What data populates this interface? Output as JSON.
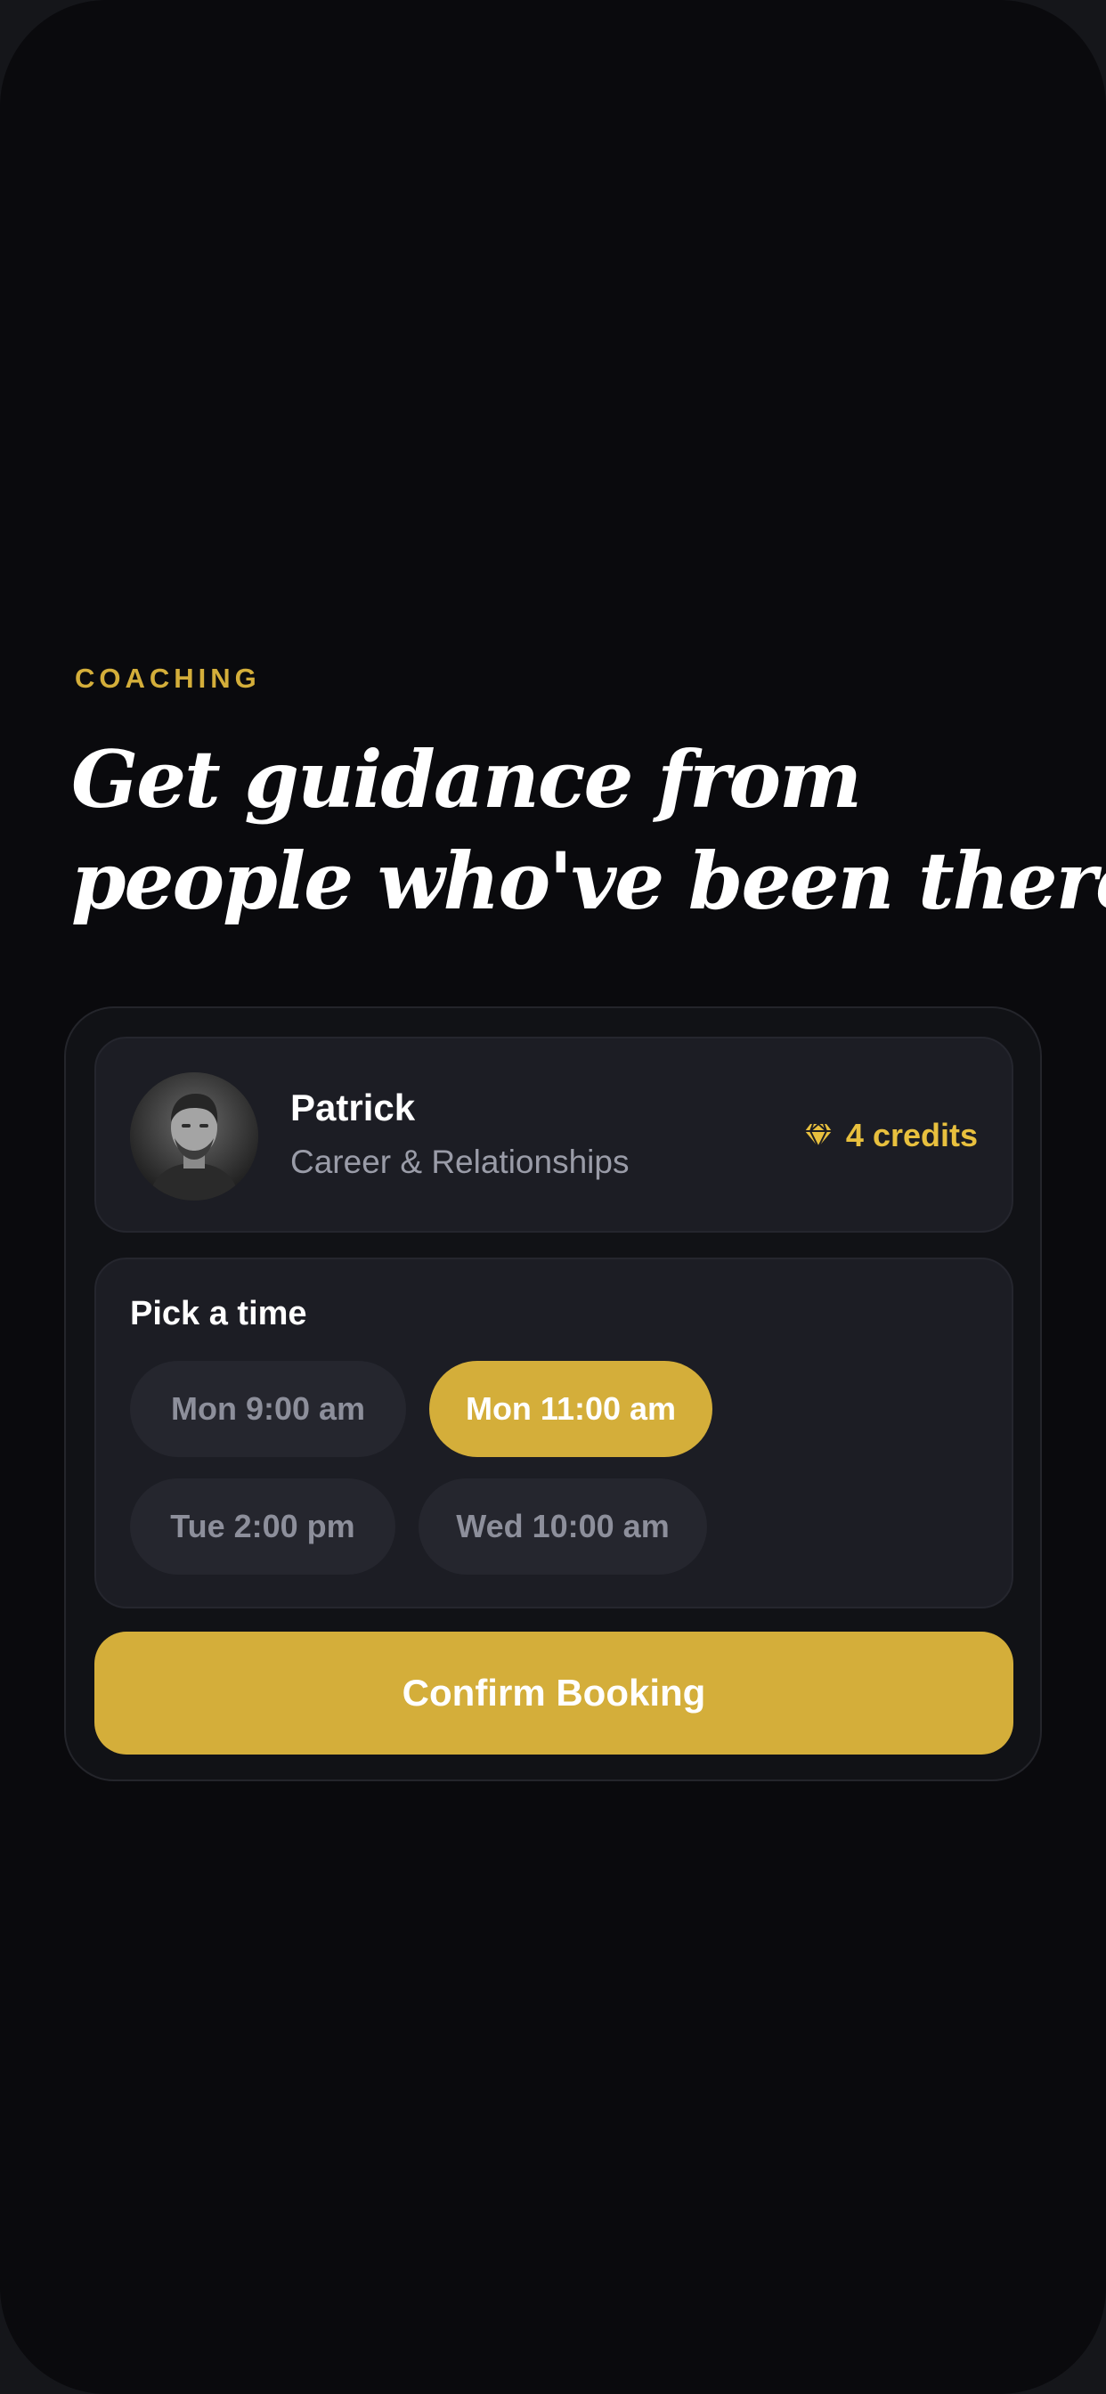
{
  "section": {
    "eyebrow": "COACHING",
    "headline_line1": "Get guidance from",
    "headline_line2": "people who've been there."
  },
  "coach": {
    "name": "Patrick",
    "specialty": "Career & Relationships",
    "credits_label": "4 credits",
    "credits_icon": "diamond-icon"
  },
  "time_picker": {
    "title": "Pick a time",
    "slots": [
      {
        "label": "Mon 9:00 am",
        "selected": false
      },
      {
        "label": "Mon 11:00 am",
        "selected": true
      },
      {
        "label": "Tue 2:00 pm",
        "selected": false
      },
      {
        "label": "Wed 10:00 am",
        "selected": false
      }
    ]
  },
  "actions": {
    "confirm_label": "Confirm Booking"
  },
  "colors": {
    "accent": "#d4ae3a",
    "background": "#0a0a0d",
    "card": "#1c1d24",
    "muted_text": "#9a9ca8"
  }
}
